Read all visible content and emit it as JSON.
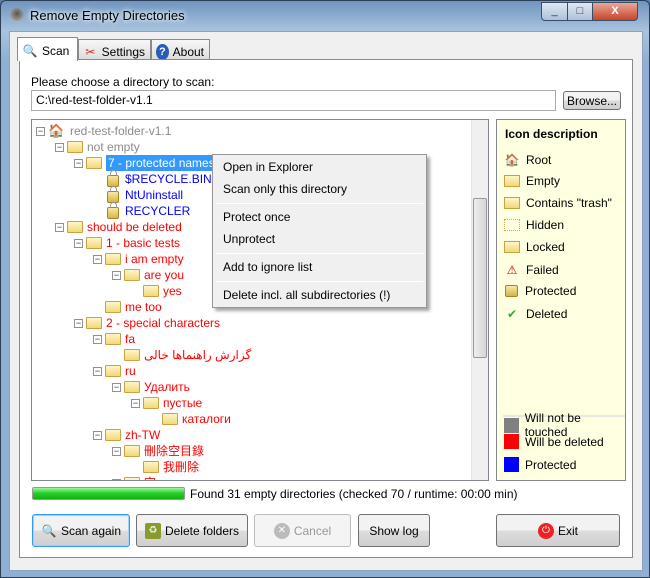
{
  "window": {
    "title": "Remove Empty Directories",
    "minimize": "_",
    "maximize": "□",
    "close": "X"
  },
  "tabs": [
    {
      "label": "Scan",
      "icon": "magnifier-icon"
    },
    {
      "label": "Settings",
      "icon": "tools-icon"
    },
    {
      "label": "About",
      "icon": "help-icon"
    }
  ],
  "scan": {
    "choose_label": "Please choose a directory to scan:",
    "path": "C:\\red-test-folder-v1.1",
    "browse": "Browse..."
  },
  "tree": [
    {
      "label": "red-test-folder-v1.1",
      "level": 0,
      "kind": "root",
      "color": "gray",
      "expander": true
    },
    {
      "label": "not empty",
      "level": 1,
      "kind": "folder",
      "color": "gray",
      "expander": true
    },
    {
      "label": "7 - protected names",
      "level": 2,
      "kind": "folder",
      "color": "blue",
      "expander": true,
      "selected": true
    },
    {
      "label": "$RECYCLE.BIN",
      "level": 3,
      "kind": "lock",
      "color": "blue"
    },
    {
      "label": "NtUninstall",
      "level": 3,
      "kind": "lock",
      "color": "blue"
    },
    {
      "label": "RECYCLER",
      "level": 3,
      "kind": "lock",
      "color": "blue"
    },
    {
      "label": "should be deleted",
      "level": 1,
      "kind": "folder",
      "color": "red",
      "expander": true
    },
    {
      "label": "1 - basic tests",
      "level": 2,
      "kind": "folder",
      "color": "red",
      "expander": true
    },
    {
      "label": "i am empty",
      "level": 3,
      "kind": "folder",
      "color": "red",
      "expander": true
    },
    {
      "label": "are you",
      "level": 4,
      "kind": "folder",
      "color": "red",
      "expander": true
    },
    {
      "label": "yes",
      "level": 5,
      "kind": "folder",
      "color": "red"
    },
    {
      "label": "me too",
      "level": 3,
      "kind": "folder",
      "color": "red"
    },
    {
      "label": "2 - special characters",
      "level": 2,
      "kind": "folder",
      "color": "red",
      "expander": true
    },
    {
      "label": "fa",
      "level": 3,
      "kind": "folder",
      "color": "red",
      "expander": true
    },
    {
      "label": "گزارش راهنماها خالی",
      "level": 4,
      "kind": "folder",
      "color": "red"
    },
    {
      "label": "ru",
      "level": 3,
      "kind": "folder",
      "color": "red",
      "expander": true
    },
    {
      "label": "Удалить",
      "level": 4,
      "kind": "folder",
      "color": "red",
      "expander": true
    },
    {
      "label": "пустые",
      "level": 5,
      "kind": "folder",
      "color": "red",
      "expander": true
    },
    {
      "label": "каталоги",
      "level": 6,
      "kind": "folder",
      "color": "red"
    },
    {
      "label": "zh-TW",
      "level": 3,
      "kind": "folder",
      "color": "red",
      "expander": true
    },
    {
      "label": "刪除空目錄",
      "level": 4,
      "kind": "folder",
      "color": "red",
      "expander": true
    },
    {
      "label": "我刪除",
      "level": 5,
      "kind": "folder",
      "color": "red"
    },
    {
      "label": "空",
      "level": 4,
      "kind": "folder",
      "color": "red",
      "expander": true
    }
  ],
  "context_menu": {
    "items": [
      "Open in Explorer",
      "Scan only this directory",
      "Protect once",
      "Unprotect",
      "Add to ignore list",
      "Delete incl. all subdirectories (!)"
    ]
  },
  "legend": {
    "title": "Icon description",
    "icons": [
      {
        "label": "Root",
        "icon": "house-icon"
      },
      {
        "label": "Empty",
        "icon": "folder-icon"
      },
      {
        "label": "Contains \"trash\"",
        "icon": "folder-plus-icon"
      },
      {
        "label": "Hidden",
        "icon": "hidden-folder-icon"
      },
      {
        "label": "Locked",
        "icon": "locked-folder-icon"
      },
      {
        "label": "Failed",
        "icon": "warning-icon"
      },
      {
        "label": "Protected",
        "icon": "padlock-icon"
      },
      {
        "label": "Deleted",
        "icon": "checkmark-icon"
      }
    ],
    "colors": [
      {
        "label": "Will not be touched",
        "color": "#808080"
      },
      {
        "label": "Will be deleted",
        "color": "#ff0000"
      },
      {
        "label": "Protected",
        "color": "#0000ff"
      }
    ]
  },
  "progress": {
    "percent": 100,
    "status": "Found 31 empty directories (checked 70 / runtime: 00:00 min)"
  },
  "buttons": {
    "scan_again": "Scan again",
    "delete_folders": "Delete folders",
    "cancel": "Cancel",
    "show_log": "Show log",
    "exit": "Exit"
  }
}
